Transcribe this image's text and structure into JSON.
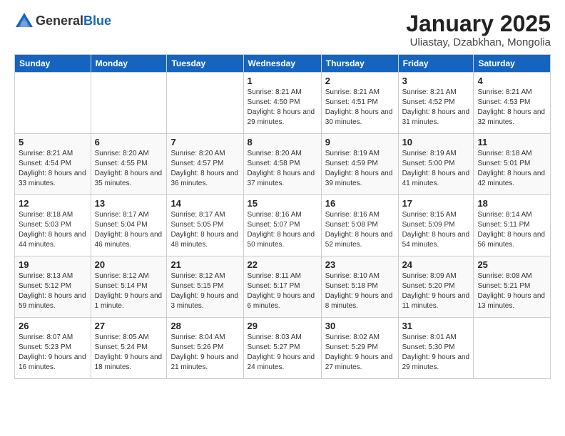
{
  "header": {
    "logo_line1": "General",
    "logo_line2": "Blue",
    "title": "January 2025",
    "subtitle": "Uliastay, Dzabkhan, Mongolia"
  },
  "days_of_week": [
    "Sunday",
    "Monday",
    "Tuesday",
    "Wednesday",
    "Thursday",
    "Friday",
    "Saturday"
  ],
  "weeks": [
    [
      {
        "day": "",
        "info": ""
      },
      {
        "day": "",
        "info": ""
      },
      {
        "day": "",
        "info": ""
      },
      {
        "day": "1",
        "info": "Sunrise: 8:21 AM\nSunset: 4:50 PM\nDaylight: 8 hours\nand 29 minutes."
      },
      {
        "day": "2",
        "info": "Sunrise: 8:21 AM\nSunset: 4:51 PM\nDaylight: 8 hours\nand 30 minutes."
      },
      {
        "day": "3",
        "info": "Sunrise: 8:21 AM\nSunset: 4:52 PM\nDaylight: 8 hours\nand 31 minutes."
      },
      {
        "day": "4",
        "info": "Sunrise: 8:21 AM\nSunset: 4:53 PM\nDaylight: 8 hours\nand 32 minutes."
      }
    ],
    [
      {
        "day": "5",
        "info": "Sunrise: 8:21 AM\nSunset: 4:54 PM\nDaylight: 8 hours\nand 33 minutes."
      },
      {
        "day": "6",
        "info": "Sunrise: 8:20 AM\nSunset: 4:55 PM\nDaylight: 8 hours\nand 35 minutes."
      },
      {
        "day": "7",
        "info": "Sunrise: 8:20 AM\nSunset: 4:57 PM\nDaylight: 8 hours\nand 36 minutes."
      },
      {
        "day": "8",
        "info": "Sunrise: 8:20 AM\nSunset: 4:58 PM\nDaylight: 8 hours\nand 37 minutes."
      },
      {
        "day": "9",
        "info": "Sunrise: 8:19 AM\nSunset: 4:59 PM\nDaylight: 8 hours\nand 39 minutes."
      },
      {
        "day": "10",
        "info": "Sunrise: 8:19 AM\nSunset: 5:00 PM\nDaylight: 8 hours\nand 41 minutes."
      },
      {
        "day": "11",
        "info": "Sunrise: 8:18 AM\nSunset: 5:01 PM\nDaylight: 8 hours\nand 42 minutes."
      }
    ],
    [
      {
        "day": "12",
        "info": "Sunrise: 8:18 AM\nSunset: 5:03 PM\nDaylight: 8 hours\nand 44 minutes."
      },
      {
        "day": "13",
        "info": "Sunrise: 8:17 AM\nSunset: 5:04 PM\nDaylight: 8 hours\nand 46 minutes."
      },
      {
        "day": "14",
        "info": "Sunrise: 8:17 AM\nSunset: 5:05 PM\nDaylight: 8 hours\nand 48 minutes."
      },
      {
        "day": "15",
        "info": "Sunrise: 8:16 AM\nSunset: 5:07 PM\nDaylight: 8 hours\nand 50 minutes."
      },
      {
        "day": "16",
        "info": "Sunrise: 8:16 AM\nSunset: 5:08 PM\nDaylight: 8 hours\nand 52 minutes."
      },
      {
        "day": "17",
        "info": "Sunrise: 8:15 AM\nSunset: 5:09 PM\nDaylight: 8 hours\nand 54 minutes."
      },
      {
        "day": "18",
        "info": "Sunrise: 8:14 AM\nSunset: 5:11 PM\nDaylight: 8 hours\nand 56 minutes."
      }
    ],
    [
      {
        "day": "19",
        "info": "Sunrise: 8:13 AM\nSunset: 5:12 PM\nDaylight: 8 hours\nand 59 minutes."
      },
      {
        "day": "20",
        "info": "Sunrise: 8:12 AM\nSunset: 5:14 PM\nDaylight: 9 hours\nand 1 minute."
      },
      {
        "day": "21",
        "info": "Sunrise: 8:12 AM\nSunset: 5:15 PM\nDaylight: 9 hours\nand 3 minutes."
      },
      {
        "day": "22",
        "info": "Sunrise: 8:11 AM\nSunset: 5:17 PM\nDaylight: 9 hours\nand 6 minutes."
      },
      {
        "day": "23",
        "info": "Sunrise: 8:10 AM\nSunset: 5:18 PM\nDaylight: 9 hours\nand 8 minutes."
      },
      {
        "day": "24",
        "info": "Sunrise: 8:09 AM\nSunset: 5:20 PM\nDaylight: 9 hours\nand 11 minutes."
      },
      {
        "day": "25",
        "info": "Sunrise: 8:08 AM\nSunset: 5:21 PM\nDaylight: 9 hours\nand 13 minutes."
      }
    ],
    [
      {
        "day": "26",
        "info": "Sunrise: 8:07 AM\nSunset: 5:23 PM\nDaylight: 9 hours\nand 16 minutes."
      },
      {
        "day": "27",
        "info": "Sunrise: 8:05 AM\nSunset: 5:24 PM\nDaylight: 9 hours\nand 18 minutes."
      },
      {
        "day": "28",
        "info": "Sunrise: 8:04 AM\nSunset: 5:26 PM\nDaylight: 9 hours\nand 21 minutes."
      },
      {
        "day": "29",
        "info": "Sunrise: 8:03 AM\nSunset: 5:27 PM\nDaylight: 9 hours\nand 24 minutes."
      },
      {
        "day": "30",
        "info": "Sunrise: 8:02 AM\nSunset: 5:29 PM\nDaylight: 9 hours\nand 27 minutes."
      },
      {
        "day": "31",
        "info": "Sunrise: 8:01 AM\nSunset: 5:30 PM\nDaylight: 9 hours\nand 29 minutes."
      },
      {
        "day": "",
        "info": ""
      }
    ]
  ]
}
